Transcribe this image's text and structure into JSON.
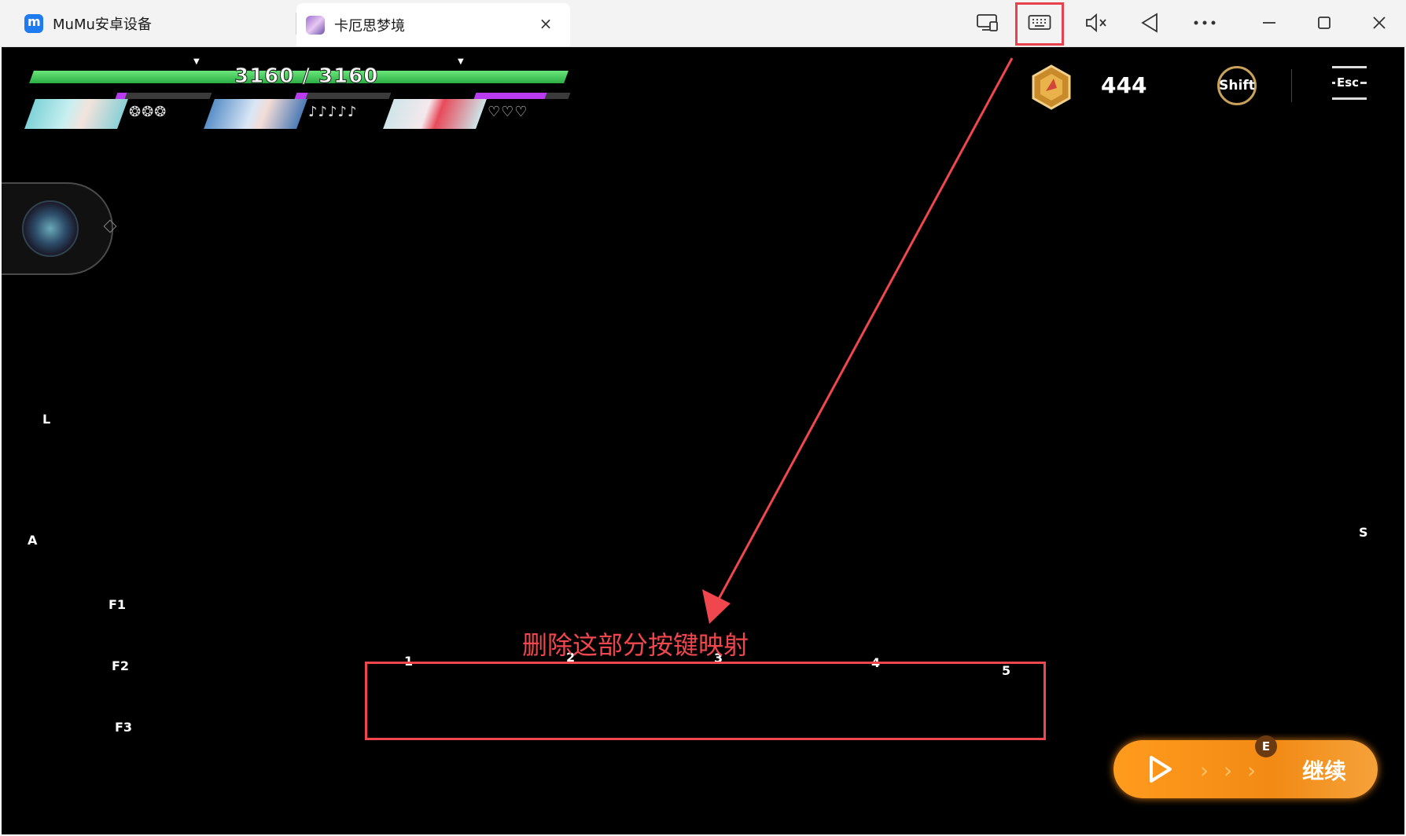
{
  "window": {
    "tabs": [
      {
        "label": "MuMu安卓设备"
      },
      {
        "label": "卡厄思梦境",
        "close": "×"
      }
    ],
    "toolbar_icons": [
      "screen-mirror-icon",
      "keyboard-icon",
      "mute-icon",
      "back-icon",
      "more-icon",
      "minimize-icon",
      "maximize-icon",
      "close-icon"
    ]
  },
  "hud": {
    "hp_text": "3160 / 3160",
    "hp_fraction": 1.0,
    "characters": [
      {
        "pips": "❂❂❂",
        "skill_fraction": 0.1
      },
      {
        "pips": "♪♪♪♪♪",
        "skill_fraction": 0.12
      },
      {
        "pips": "♡♡♡",
        "skill_fraction": 0.75
      }
    ],
    "currency": "444",
    "shift_label": "Shift",
    "esc_label": "Esc"
  },
  "key_labels": {
    "L": "L",
    "A": "A",
    "S": "S",
    "F1": "F1",
    "F2": "F2",
    "F3": "F3",
    "k1": "1",
    "k2": "2",
    "k3": "3",
    "k4": "4",
    "k5": "5"
  },
  "annotation": {
    "text": "删除这部分按键映射",
    "color": "#f0474f"
  },
  "continue_button": {
    "label": "继续",
    "key": "E"
  },
  "colors": {
    "accent_red": "#e8414e",
    "hp_green": "#2cae45",
    "continue_orange": "#f28a14"
  }
}
